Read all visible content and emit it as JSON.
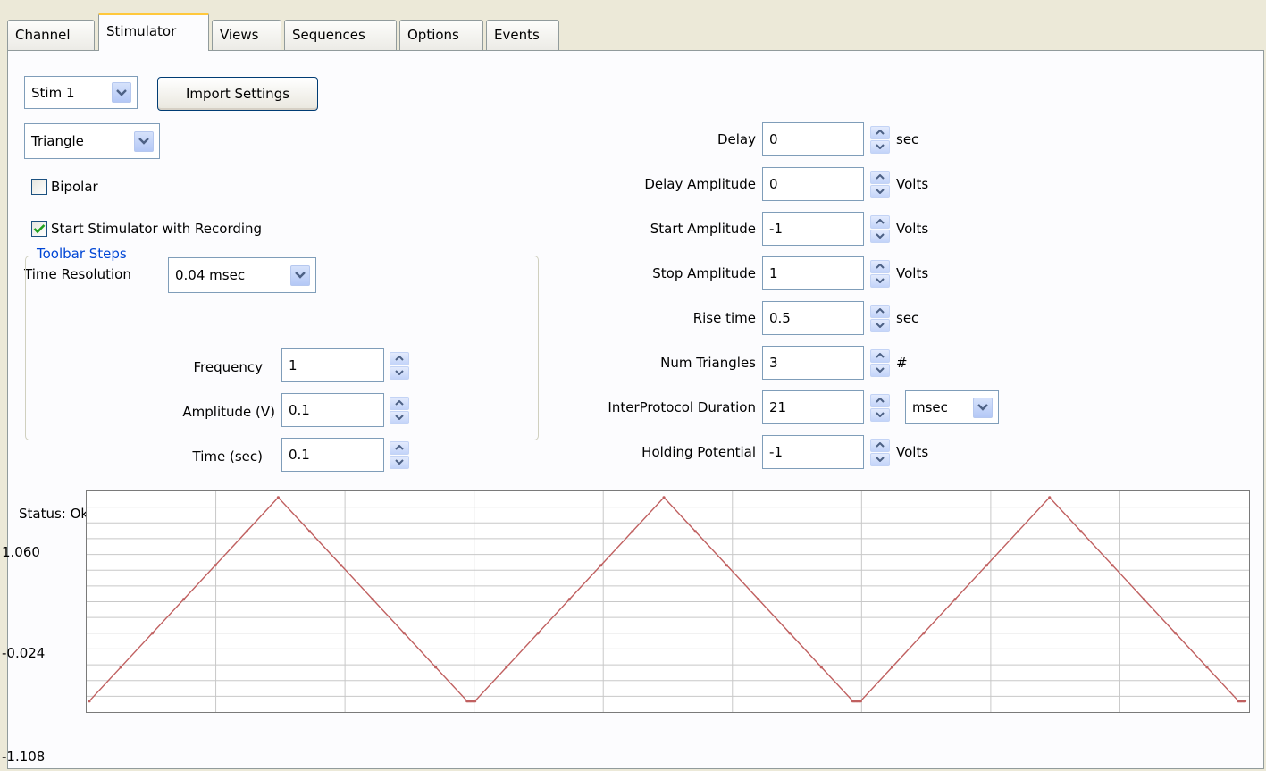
{
  "tabs": [
    "Channel",
    "Stimulator",
    "Views",
    "Sequences",
    "Options",
    "Events"
  ],
  "active_tab": "Stimulator",
  "stim_select": "Stim 1",
  "import_button": "Import Settings",
  "waveform_select": "Triangle",
  "bipolar": {
    "label": "Bipolar",
    "checked": false
  },
  "start_with_recording": {
    "label": "Start Stimulator with Recording",
    "checked": true
  },
  "time_resolution": {
    "label": "Time Resolution",
    "value": "0.04 msec"
  },
  "toolbar_steps": {
    "title": "Toolbar Steps",
    "frequency": {
      "label": "Frequency",
      "value": "1"
    },
    "amplitude": {
      "label": "Amplitude (V)",
      "value": "0.1"
    },
    "time": {
      "label": "Time (sec)",
      "value": "0.1"
    }
  },
  "params": [
    {
      "label": "Delay",
      "value": "0",
      "unit": "sec"
    },
    {
      "label": "Delay Amplitude",
      "value": "0",
      "unit": "Volts"
    },
    {
      "label": "Start Amplitude",
      "value": "-1",
      "unit": "Volts"
    },
    {
      "label": "Stop Amplitude",
      "value": "1",
      "unit": "Volts"
    },
    {
      "label": "Rise time",
      "value": "0.5",
      "unit": "sec"
    },
    {
      "label": "Num Triangles",
      "value": "3",
      "unit": "#"
    },
    {
      "label": "InterProtocol Duration",
      "value": "21",
      "unit": "msec"
    },
    {
      "label": "Holding Potential",
      "value": "-1",
      "unit": "Volts"
    }
  ],
  "status": "Status: Ok",
  "colors": {
    "accent": "#0046d5",
    "trace": "#c06060",
    "tab_highlight": "#ffc83c"
  },
  "chart_data": {
    "type": "line",
    "title": "",
    "xlabel": "",
    "ylabel": "",
    "ytick_labels": [
      "1.060",
      "-0.024",
      "-1.108"
    ],
    "ylim": [
      -1.108,
      1.06
    ],
    "grid": true,
    "series": [
      {
        "x": [
          0,
          0.5,
          1.0,
          1.021,
          1.521,
          2.021,
          2.042,
          2.542,
          3.042,
          3.063
        ],
        "y": [
          -1,
          1,
          -1,
          -1,
          1,
          -1,
          -1,
          1,
          -1,
          -1
        ]
      }
    ]
  }
}
